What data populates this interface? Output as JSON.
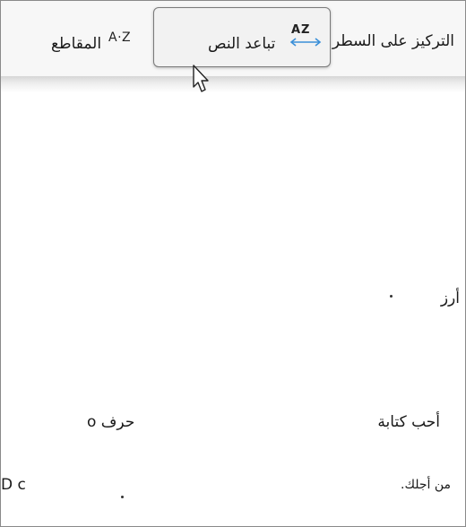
{
  "toolbar": {
    "line_focus_label": "التركيز على السطر",
    "text_spacing_label": "تباعد النص",
    "text_spacing_icon_text": "AZ",
    "syllables_label": "المقاطع",
    "syllables_icon_text": "A·Z"
  },
  "document": {
    "word_rice": "أرز",
    "word_i_love_writing": "أحب كتابة",
    "word_letter_o": "حرف o",
    "word_for_you": "من أجلك.",
    "fragment_left": "D c"
  },
  "icons": {
    "text_spacing": "text-spacing-icon",
    "syllables": "syllables-icon",
    "cursor": "mouse-pointer-icon"
  },
  "colors": {
    "accent": "#3a8fd8",
    "ribbon_bg": "#f7f7f7",
    "button_border": "#7a7a7a"
  }
}
